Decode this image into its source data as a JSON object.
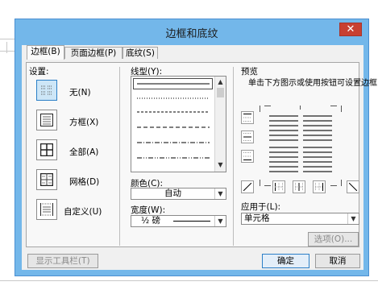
{
  "dialog": {
    "title": "边框和底纹",
    "close_glyph": "✕"
  },
  "tabs": [
    {
      "label": "边框(B)"
    },
    {
      "label": "页面边框(P)"
    },
    {
      "label": "底纹(S)"
    }
  ],
  "settings": {
    "heading": "设置:",
    "options": [
      {
        "label": "无(N)",
        "icon": "border-none-icon"
      },
      {
        "label": "方框(X)",
        "icon": "border-box-icon"
      },
      {
        "label": "全部(A)",
        "icon": "border-all-icon"
      },
      {
        "label": "网格(D)",
        "icon": "border-grid-icon"
      },
      {
        "label": "自定义(U)",
        "icon": "border-custom-icon"
      }
    ]
  },
  "line_style": {
    "heading": "线型(Y):",
    "styles": [
      "solid",
      "dotted",
      "dashed-short",
      "dashed",
      "dash-dot",
      "dash-dot-dot"
    ]
  },
  "color": {
    "label": "颜色(C):",
    "value": "自动"
  },
  "width": {
    "label": "宽度(W):",
    "value": "½ 磅"
  },
  "preview": {
    "heading": "预览",
    "instruction": "单击下方图示或使用按钮可设置边框"
  },
  "apply_to": {
    "label": "应用于(L):",
    "value": "单元格"
  },
  "buttons": {
    "options": "选项(O)...",
    "show_toolbar": "显示工具栏(T)",
    "ok": "确定",
    "cancel": "取消"
  },
  "colors": {
    "title_bar": "#73b7ea",
    "close": "#c84031",
    "selected": "#cde6f7"
  }
}
